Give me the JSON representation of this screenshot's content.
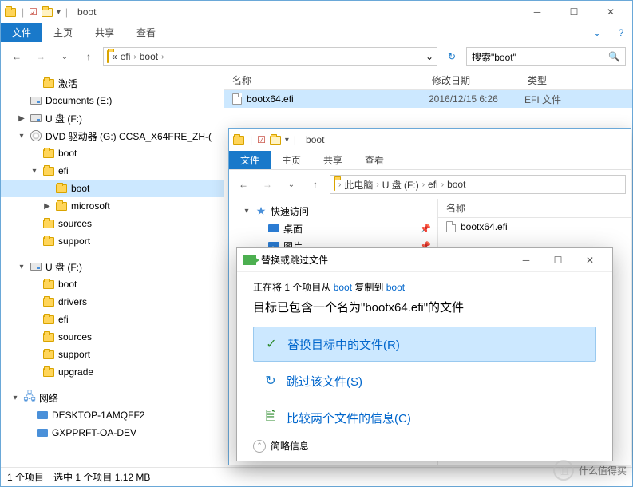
{
  "win1": {
    "title": "boot",
    "ribbon": {
      "file": "文件",
      "home": "主页",
      "share": "共享",
      "view": "查看"
    },
    "breadcrumb": [
      "efi",
      "boot"
    ],
    "bc_prefix": "«",
    "search_placeholder": "搜索\"boot\"",
    "tree": [
      {
        "t": "激活",
        "ic": "folder",
        "ind": 36
      },
      {
        "t": "Documents (E:)",
        "ic": "drive",
        "ind": 20,
        "exp": ""
      },
      {
        "t": "U 盘 (F:)",
        "ic": "drive",
        "ind": 20,
        "exp": "▶"
      },
      {
        "t": "DVD 驱动器 (G:) CCSA_X64FRE_ZH-(",
        "ic": "dvd",
        "ind": 20,
        "exp": "▾"
      },
      {
        "t": "boot",
        "ic": "folder",
        "ind": 36
      },
      {
        "t": "efi",
        "ic": "folder",
        "ind": 36,
        "exp": "▾"
      },
      {
        "t": "boot",
        "ic": "folder",
        "ind": 52,
        "sel": true
      },
      {
        "t": "microsoft",
        "ic": "folder",
        "ind": 52,
        "exp": "▶"
      },
      {
        "t": "sources",
        "ic": "folder",
        "ind": 36
      },
      {
        "t": "support",
        "ic": "folder",
        "ind": 36
      },
      {
        "t": "",
        "ic": "",
        "ind": 0,
        "blank": true
      },
      {
        "t": "U 盘 (F:)",
        "ic": "drive",
        "ind": 20,
        "exp": "▾"
      },
      {
        "t": "boot",
        "ic": "folder",
        "ind": 36
      },
      {
        "t": "drivers",
        "ic": "folder",
        "ind": 36
      },
      {
        "t": "efi",
        "ic": "folder",
        "ind": 36
      },
      {
        "t": "sources",
        "ic": "folder",
        "ind": 36
      },
      {
        "t": "support",
        "ic": "folder",
        "ind": 36
      },
      {
        "t": "upgrade",
        "ic": "folder",
        "ind": 36
      },
      {
        "t": "",
        "ic": "",
        "ind": 0,
        "blank": true
      },
      {
        "t": "网络",
        "ic": "net",
        "ind": 12,
        "exp": "▾"
      },
      {
        "t": "DESKTOP-1AMQFF2",
        "ic": "pc",
        "ind": 28
      },
      {
        "t": "GXPPRFT-OA-DEV",
        "ic": "pc",
        "ind": 28
      }
    ],
    "cols": {
      "name": "名称",
      "date": "修改日期",
      "type": "类型"
    },
    "files": [
      {
        "name": "bootx64.efi",
        "date": "2016/12/15 6:26",
        "type": "EFI 文件"
      }
    ],
    "status": {
      "items": "1 个项目",
      "sel": "选中 1 个项目 1.12 MB"
    }
  },
  "win2": {
    "title": "boot",
    "ribbon": {
      "file": "文件",
      "home": "主页",
      "share": "共享",
      "view": "查看"
    },
    "breadcrumb": [
      "此电脑",
      "U 盘 (F:)",
      "efi",
      "boot"
    ],
    "tree": [
      {
        "t": "快速访问",
        "ic": "star",
        "ind": 16,
        "exp": "▾"
      },
      {
        "t": "桌面",
        "ic": "desk",
        "ind": 32,
        "pin": true
      },
      {
        "t": "图片",
        "ic": "pic",
        "ind": 32,
        "pin": true
      }
    ],
    "cols": {
      "name": "名称"
    },
    "files": [
      {
        "name": "bootx64.efi"
      }
    ]
  },
  "dlg": {
    "title": "替换或跳过文件",
    "info_pre": "正在将 1 个项目从 ",
    "info_src": "boot",
    "info_mid": " 复制到 ",
    "info_dst": "boot",
    "msg": "目标已包含一个名为\"bootx64.efi\"的文件",
    "opt1": "替换目标中的文件(R)",
    "opt2": "跳过该文件(S)",
    "opt3": "比较两个文件的信息(C)",
    "more": "简略信息"
  },
  "watermark": "什么值得买"
}
